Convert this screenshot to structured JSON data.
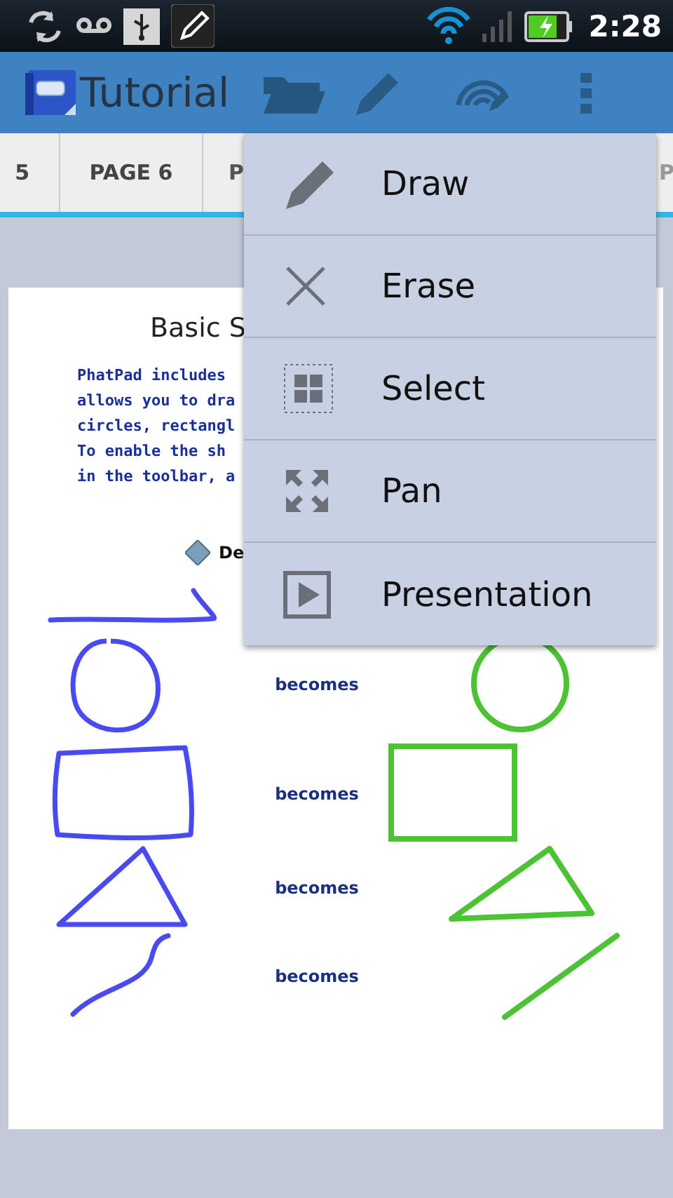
{
  "status_bar": {
    "time": "2:28"
  },
  "action_bar": {
    "title": "Tutorial"
  },
  "tabs": [
    {
      "label": "5"
    },
    {
      "label": "PAGE 6"
    },
    {
      "label": "P"
    },
    {
      "label": "P"
    }
  ],
  "document": {
    "title": "Basic S",
    "paragraph_lines": [
      "PhatPad includes",
      "allows you to dra",
      "circles, rectangl",
      "To enable the sh",
      "in the toolbar, a"
    ],
    "legend": "De",
    "rows": [
      {
        "kind": "circle",
        "label": "becomes"
      },
      {
        "kind": "rectangle",
        "label": "becomes"
      },
      {
        "kind": "triangle",
        "label": "becomes"
      },
      {
        "kind": "line",
        "label": "becomes"
      }
    ]
  },
  "menu": {
    "items": [
      {
        "label": "Draw"
      },
      {
        "label": "Erase"
      },
      {
        "label": "Select"
      },
      {
        "label": "Pan"
      },
      {
        "label": "Presentation"
      }
    ]
  }
}
